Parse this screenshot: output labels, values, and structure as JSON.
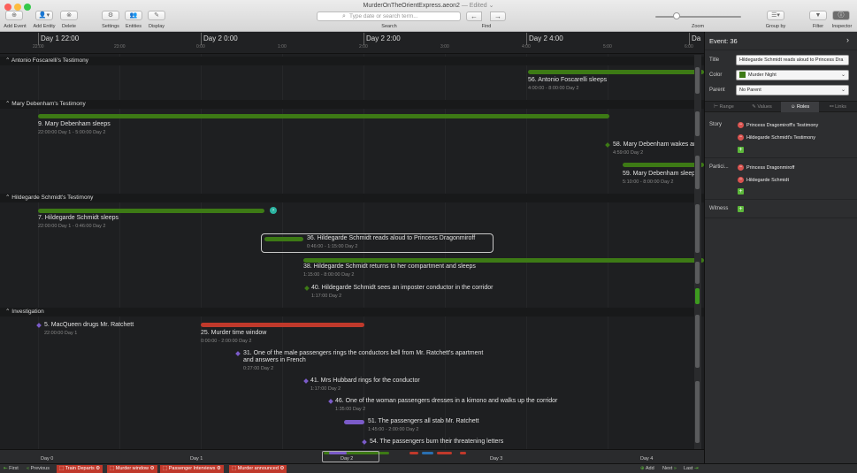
{
  "window": {
    "title": "MurderOnTheOrientExpress.aeon2",
    "edited": "— Edited ⌄"
  },
  "toolbar": {
    "add_event": "Add Event",
    "add_entity": "Add Entity",
    "delete": "Delete",
    "settings": "Settings",
    "entities": "Entities",
    "display": "Display",
    "search_label": "Search",
    "search_placeholder": "Type date or search term...",
    "find_label": "Find",
    "zoom_label": "Zoom",
    "group_by": "Group by",
    "filter": "Filter",
    "inspector": "Inspector"
  },
  "ruler": {
    "days": [
      "Day 1 22:00",
      "Day 2 0:00",
      "Day 2 2:00",
      "Day 2 4:00",
      "Da"
    ],
    "sub_ticks": [
      "22:00",
      "23:00",
      "0:00",
      "1:00",
      "2:00",
      "3:00",
      "4:00",
      "5:00",
      "6:00"
    ]
  },
  "groups": [
    {
      "title": "Antonio Foscarelli's Testimony"
    },
    {
      "title": "Mary Debenham's Testimony"
    },
    {
      "title": "Hildegarde Schmidt's Testimony"
    },
    {
      "title": "Investigation"
    }
  ],
  "events": [
    {
      "title": "56. Antonio Foscarelli sleeps",
      "time": "4:00:00 - 8:00:00 Day 2",
      "color": "#3d7a15"
    },
    {
      "title": "9. Mary Debenham sleeps",
      "time": "22:00:00 Day 1 - 5:00:00 Day 2",
      "color": "#3d7a15"
    },
    {
      "title": "58. Mary Debenham wakes and",
      "time": "4:59:00 Day 2",
      "color": "#3d7a15"
    },
    {
      "title": "59. Mary Debenham sleeps",
      "time": "5:10:00 - 8:00:00 Day 2",
      "color": "#3d7a15"
    },
    {
      "title": "7. Hildegarde Schmidt sleeps",
      "time": "22:00:00 Day 1 - 0:46:00 Day 2",
      "color": "#3d7a15"
    },
    {
      "title": "36. Hildegarde Schmidt reads aloud to Princess Dragonmiroff",
      "time": "0:46:00 - 1:15:00 Day 2",
      "color": "#3d7a15"
    },
    {
      "title": "38. Hildegarde Schmidt returns to her compartment and sleeps",
      "time": "1:15:00 - 8:00:00 Day 2",
      "color": "#3d7a15"
    },
    {
      "title": "40. Hildegarde Schmidt sees an imposter conductor in the corridor",
      "time": "1:17:00 Day 2",
      "color": "#3d7a15"
    },
    {
      "title": "5. MacQueen drugs Mr. Ratchett",
      "time": "22:00:00 Day 1",
      "color": "#7b5bc9"
    },
    {
      "title": "25. Murder time window",
      "time": "0:00:00 - 2:00:00 Day 2",
      "color": "#c0392b"
    },
    {
      "title": "31. One of the male passengers rings the conductors bell from Mr. Ratchett's apartment",
      "title2": "and answers in French",
      "time": "0:27:00 Day 2",
      "color": "#7b5bc9"
    },
    {
      "title": "41. Mrs Hubbard rings for the conductor",
      "time": "1:17:00 Day 2",
      "color": "#7b5bc9"
    },
    {
      "title": "46. One of the woman passengers dresses in a kimono and walks up the corridor",
      "time": "1:35:00 Day 2",
      "color": "#7b5bc9"
    },
    {
      "title": "51. The passengers all stab Mr. Ratchett",
      "time": "1:45:00 - 2:00:00 Day 2",
      "color": "#7b5bc9"
    },
    {
      "title": "54. The passengers burn their threatening letters",
      "time": "",
      "color": "#7b5bc9"
    }
  ],
  "minimap": {
    "days": [
      "Day 0",
      "Day 1",
      "Day 2",
      "Day 3",
      "Day 4"
    ]
  },
  "bottombar": {
    "first": "First",
    "previous": "Previous",
    "tags": [
      "Train Departs",
      "Murder window",
      "Passenger Interviews",
      "Murder announced"
    ],
    "add": "Add",
    "next": "Next",
    "last": "Last"
  },
  "inspector": {
    "title": "Event: 36",
    "title_label": "Title",
    "title_value": "Hildegarde Schmidt reads aloud to Princess Dra",
    "color_label": "Color",
    "color_value": "Murder Night",
    "parent_label": "Parent",
    "parent_value": "No Parent",
    "tabs": [
      "Range",
      "Values",
      "Roles",
      "Links"
    ],
    "story_label": "Story",
    "story_items": [
      "Princess Dragomiroff's Testimony",
      "Hildegarde Schmidt's Testimony"
    ],
    "participant_label": "Partici...",
    "participant_items": [
      "Princess Dragonmiroff",
      "Hildegarde Schmidt"
    ],
    "witness_label": "Witness"
  },
  "colors": {
    "green": "#3d7a15",
    "purple": "#7b5bc9",
    "red": "#c0392b"
  }
}
